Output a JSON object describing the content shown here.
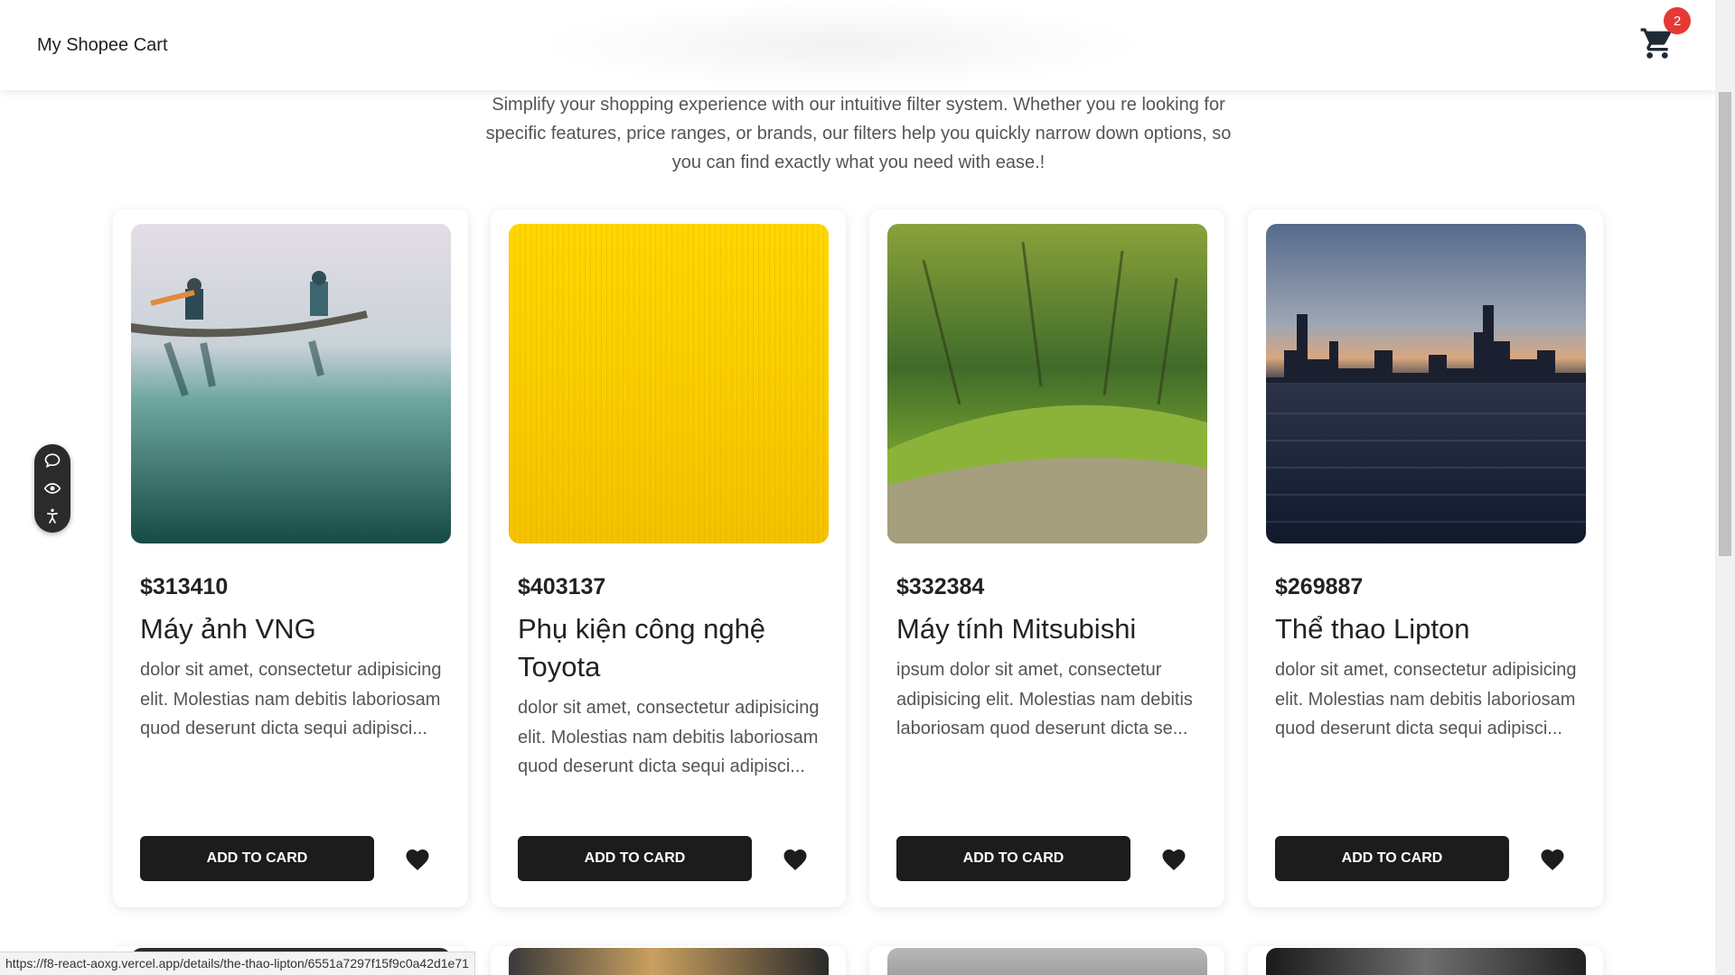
{
  "header": {
    "brand": "My Shopee Cart",
    "cart_count": "2"
  },
  "intro": {
    "text": "Simplify your shopping experience with our intuitive filter system. Whether you re looking for specific features, price ranges, or brands, our filters help you quickly narrow down options, so you can find exactly what you need with ease.!"
  },
  "products": [
    {
      "price": "$313410",
      "title": "Máy ảnh VNG",
      "desc": "dolor sit amet, consectetur adipisicing elit. Molestias nam debitis laboriosam quod deserunt dicta sequi adipisci...",
      "image": "canoe-on-misty-lake"
    },
    {
      "price": "$403137",
      "title": "Phụ kiện công nghệ Toyota",
      "desc": "dolor sit amet, consectetur adipisicing elit. Molestias nam debitis laboriosam quod deserunt dicta sequi adipisci...",
      "image": "yellow-texture"
    },
    {
      "price": "$332384",
      "title": "Máy tính Mitsubishi",
      "desc": "ipsum dolor sit amet, consectetur adipisicing elit. Molestias nam debitis laboriosam quod deserunt dicta se...",
      "image": "moss-forest"
    },
    {
      "price": "$269887",
      "title": "Thể thao Lipton",
      "desc": "dolor sit amet, consectetur adipisicing elit. Molestias nam debitis laboriosam quod deserunt dicta sequi adipisci...",
      "image": "city-skyline-water"
    }
  ],
  "buttons": {
    "add_to_cart": "ADD TO CARD"
  },
  "status_bar": {
    "url": "https://f8-react-aoxg.vercel.app/details/the-thao-lipton/6551a7297f15f9c0a42d1e71"
  },
  "colors": {
    "button": "#1c1c1c",
    "badge": "#e53935",
    "text_muted": "#555555"
  }
}
